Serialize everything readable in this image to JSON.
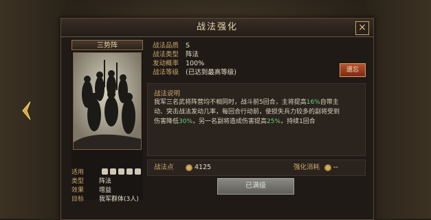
{
  "dialog": {
    "title": "战法强化",
    "close_icon": "×"
  },
  "card": {
    "name": "三势阵",
    "rows": [
      {
        "label": "适用",
        "value": ""
      },
      {
        "label": "类型",
        "value": "阵法"
      },
      {
        "label": "效果",
        "value": "增益"
      },
      {
        "label": "目标",
        "value": "我军群体(3人)"
      }
    ]
  },
  "info": {
    "quality_label": "战法品质",
    "quality_value": "S",
    "type_label": "战法类型",
    "type_value": "阵法",
    "rate_label": "发动概率",
    "rate_value": "100%",
    "level_label": "战法等级",
    "level_value": "(已达到最高等级)",
    "upgrade_button": "遗忘"
  },
  "description": {
    "title": "战法说明",
    "line1a": "我军三名武将阵营均不相同时，战斗前5回合，主将提高",
    "line1b": "16%",
    "line1c": "自带主",
    "line2": "动、突击战法发动几率，每回合行动前，使损失兵力较多的副将受到",
    "line3a": "伤害降低",
    "line3b": "30%",
    "line3c": "，另一名副将造成伤害提高",
    "line3d": "25%",
    "line3e": "，持续1回合"
  },
  "bottom": {
    "points_label": "战法点",
    "points_value": "4125",
    "enhance_label": "强化消耗",
    "enhance_value": "--"
  },
  "done_button": "已满级"
}
